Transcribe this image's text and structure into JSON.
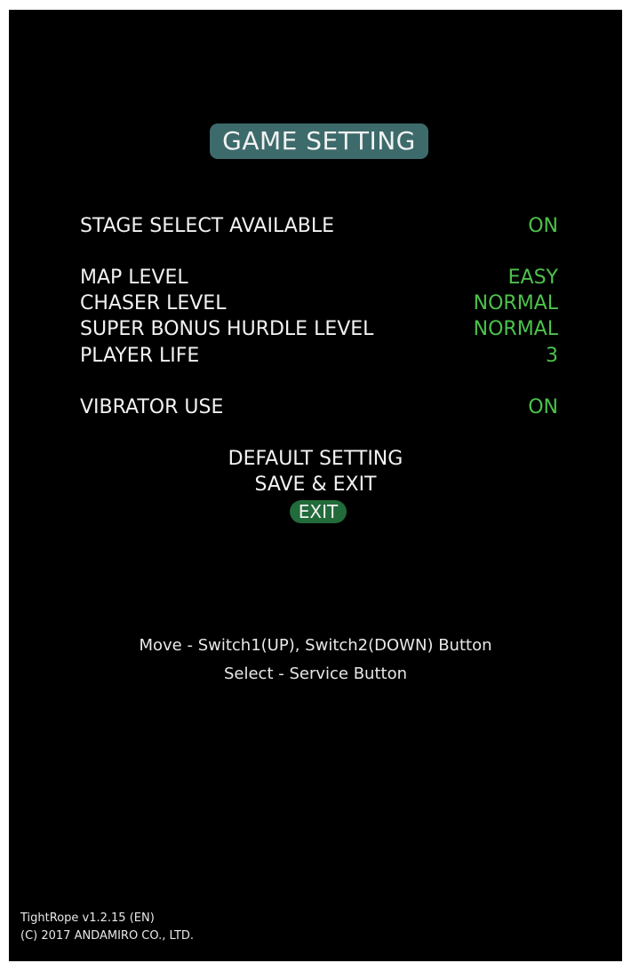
{
  "title": "GAME SETTING",
  "settings": {
    "stage_select": {
      "label": "STAGE SELECT AVAILABLE",
      "value": "ON"
    },
    "map_level": {
      "label": "MAP LEVEL",
      "value": "EASY"
    },
    "chaser_level": {
      "label": "CHASER LEVEL",
      "value": "NORMAL"
    },
    "super_bonus": {
      "label": "SUPER BONUS HURDLE LEVEL",
      "value": "NORMAL"
    },
    "player_life": {
      "label": "PLAYER LIFE",
      "value": "3"
    },
    "vibrator_use": {
      "label": "VIBRATOR USE",
      "value": "ON"
    }
  },
  "menu": {
    "default_setting": "DEFAULT SETTING",
    "save_exit": "SAVE & EXIT",
    "exit": "EXIT"
  },
  "help": {
    "move": "Move - Switch1(UP), Switch2(DOWN) Button",
    "select": "Select - Service Button"
  },
  "footer": {
    "version": "TightRope v1.2.15 (EN)",
    "copyright": "(C) 2017 ANDAMIRO CO., LTD."
  },
  "colors": {
    "background": "#000000",
    "title_badge": "#3d6a6b",
    "value_green": "#4cc24c",
    "selected_pill": "#226b3a",
    "text": "#f2f2f2"
  }
}
